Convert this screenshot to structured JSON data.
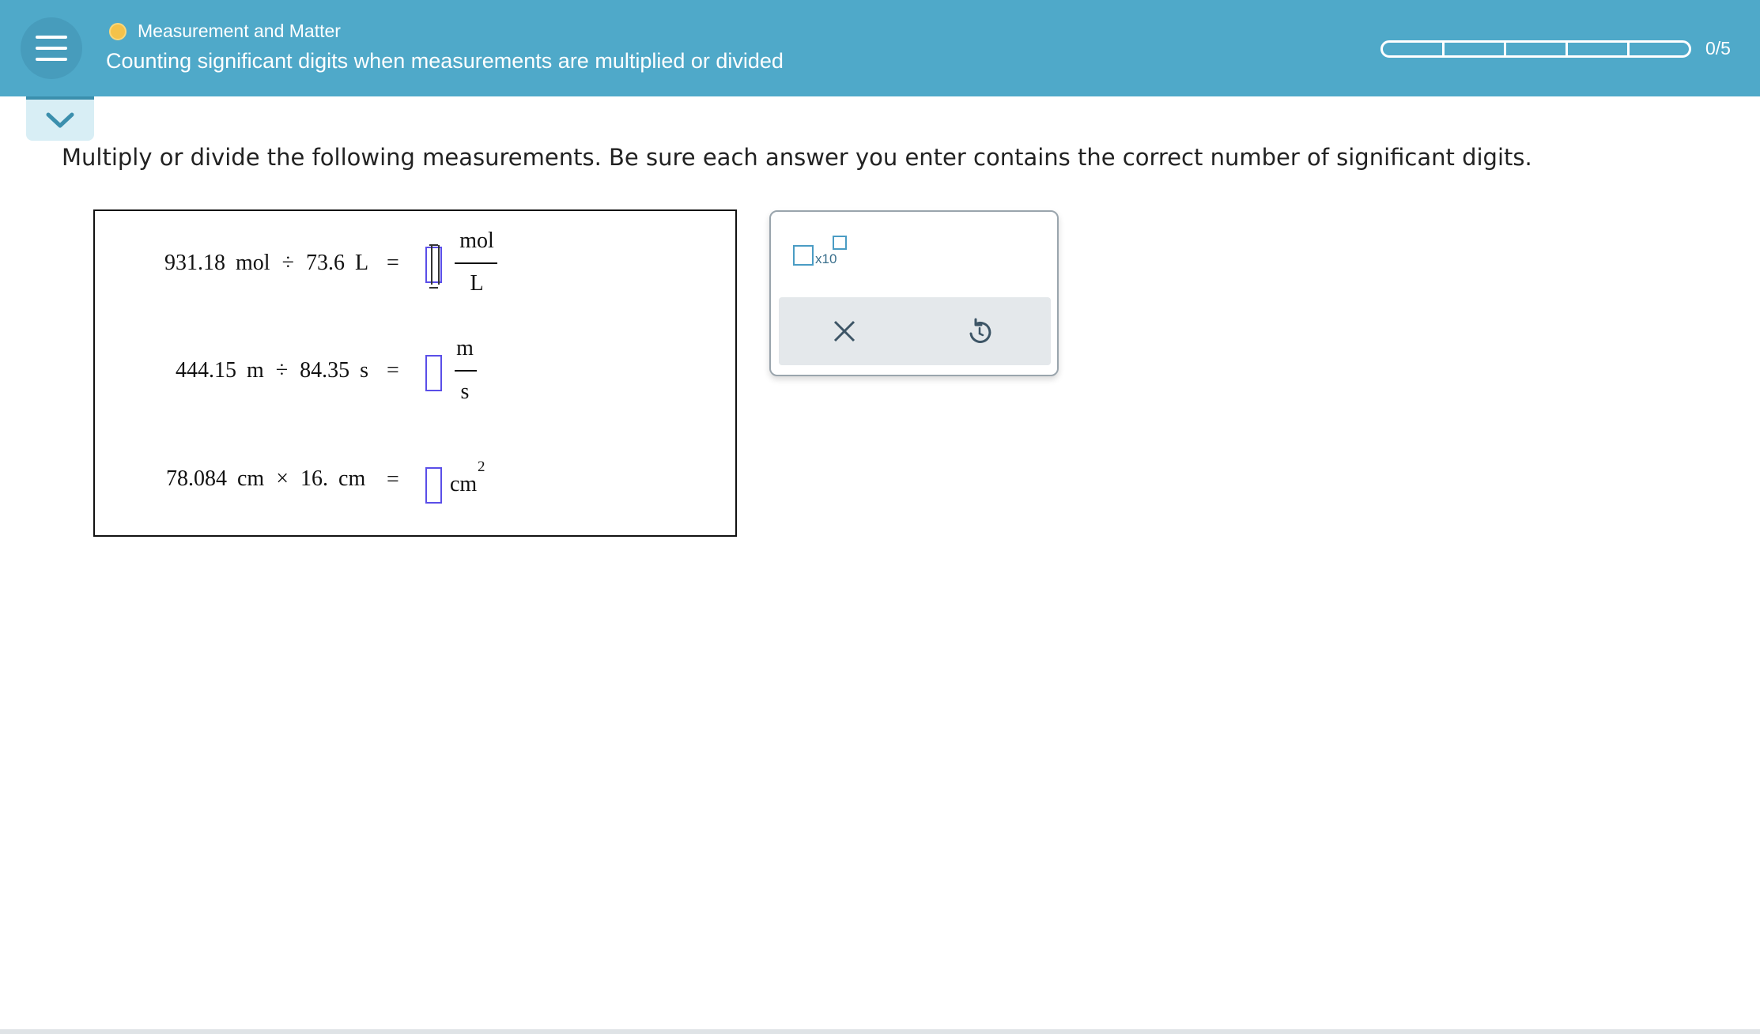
{
  "header": {
    "topic": "Measurement and Matter",
    "title": "Counting significant digits when measurements are multiplied or divided",
    "progress_text": "0/5",
    "progress": {
      "completed": 0,
      "total": 5
    },
    "colors": {
      "bar": "#4fa9c9",
      "topic_dot": "#f4c24a"
    },
    "icons": {
      "menu": "hamburger-menu-icon",
      "collapse": "chevron-down-icon"
    }
  },
  "instruction": "Multiply or divide the following measurements. Be sure each answer you enter contains the correct number of significant digits.",
  "problems": [
    {
      "a": "931.18",
      "a_unit": "mol",
      "op": "÷",
      "b": "73.6",
      "b_unit": "L",
      "eq": "=",
      "unit_num": "mol",
      "unit_den": "L",
      "answer": ""
    },
    {
      "a": "444.15",
      "a_unit": "m",
      "op": "÷",
      "b": "84.35",
      "b_unit": "s",
      "eq": "=",
      "unit_num": "m",
      "unit_den": "s",
      "answer": ""
    },
    {
      "a": "78.084",
      "a_unit": "cm",
      "op": "×",
      "b": "16.",
      "b_unit": "cm",
      "eq": "=",
      "unit": "cm",
      "exponent": "2",
      "answer": ""
    }
  ],
  "tools": {
    "sci_label": "x10",
    "icons": {
      "sci": "scientific-notation-icon",
      "clear": "close-icon",
      "undo": "undo-icon"
    }
  }
}
